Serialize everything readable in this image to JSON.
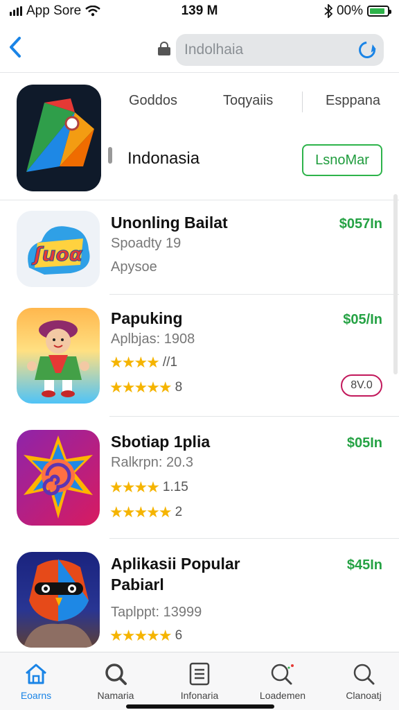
{
  "status_bar": {
    "carrier": "App Sore",
    "time": "139 M",
    "battery": "00%"
  },
  "nav": {
    "url": "Indolhaia"
  },
  "featured": {
    "tabs": [
      "Goddos",
      "Toqyaiis",
      "Esppana"
    ],
    "title": "Indonasia",
    "button": "LsnoMar"
  },
  "apps": [
    {
      "name": "Unonling Bailat",
      "sub1": "Spoadty 19",
      "sub2": "Apysoe",
      "price": "$057In"
    },
    {
      "name": "Papuking",
      "sub1": "Aplbjas: 1908",
      "stars1": "★★★★",
      "rating1": "//1",
      "stars2": "★★★★★",
      "rating2": "8",
      "price": "$05/In",
      "pill": "8V.0"
    },
    {
      "name": "Sbotiap 1plia",
      "sub1": "Ralkrpn: 20.3",
      "stars1": "★★★★",
      "rating1": "1.15",
      "stars2": "★★★★★",
      "rating2": "2",
      "price": "$05In"
    },
    {
      "name": "Aplikasii Popular",
      "name2": "Pabiarl",
      "sub1": "Taplppt: 13999",
      "stars1": "★★★★★",
      "rating1": "6",
      "price": "$45In"
    }
  ],
  "tabbar": [
    {
      "label": "Eoarns",
      "icon": "home-icon"
    },
    {
      "label": "Namaria",
      "icon": "search-icon"
    },
    {
      "label": "Infonaria",
      "icon": "document-icon"
    },
    {
      "label": "Loademen",
      "icon": "search-icon"
    },
    {
      "label": "Clanoatj",
      "icon": "search-icon"
    }
  ],
  "colors": {
    "accent": "#1a84e6",
    "price": "#25a244",
    "button_border": "#2db34a",
    "star": "#f5b400"
  }
}
